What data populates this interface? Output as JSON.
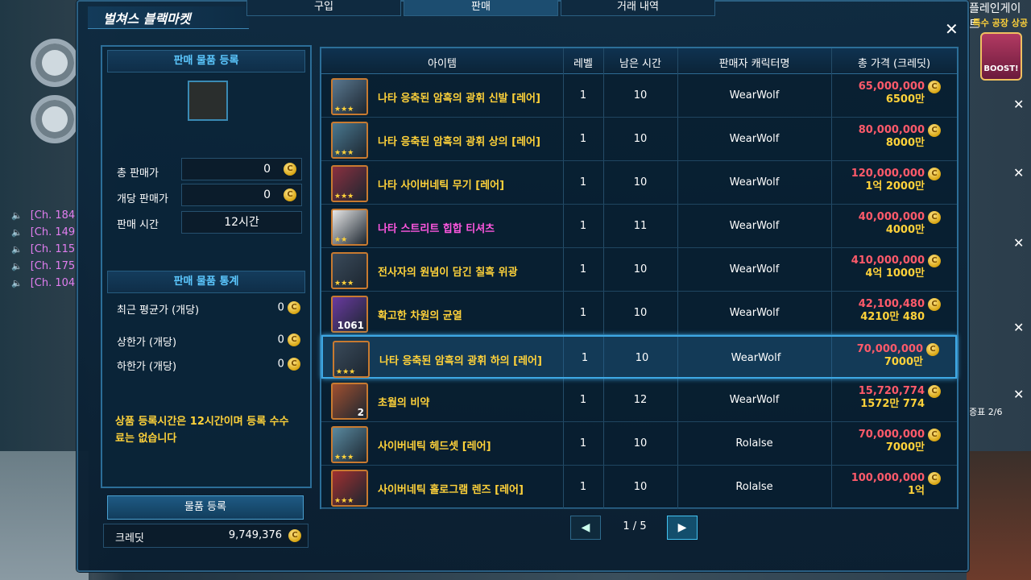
{
  "window": {
    "title": "벌쳐스 블랙마켓",
    "tabs": [
      {
        "label": "구입"
      },
      {
        "label": "판매"
      },
      {
        "label": "거래 내역"
      }
    ],
    "active_tab": 1,
    "close": "✕"
  },
  "left": {
    "register_header": "판매 물품 등록",
    "total_price_label": "총 판매가",
    "total_price_value": "0",
    "unit_price_label": "개당 판매가",
    "unit_price_value": "0",
    "sell_time_label": "판매 시간",
    "sell_time_value": "12시간",
    "stats_header": "판매 물품 통계",
    "recent_avg_label": "최근 평균가 (개당)",
    "recent_avg_value": "0",
    "upper_label": "상한가 (개당)",
    "upper_value": "0",
    "lower_label": "하한가 (개당)",
    "lower_value": "0",
    "notice": "상품 등록시간은 12시간이며 등록 수수료는 없습니다",
    "register_button": "물품 등록",
    "credit_label": "크레딧",
    "credit_value": "9,749,376"
  },
  "table": {
    "headers": [
      "아이템",
      "레벨",
      "남은 시간",
      "판매자 캐릭터명",
      "총 가격 (크레딧)"
    ],
    "rows": [
      {
        "name": "나타 응축된 암흑의 광휘 신발 [레어]",
        "level": "1",
        "time": "10",
        "seller": "WearWolf",
        "price": "65,000,000",
        "price_sub": "6500만",
        "stars": "★★★",
        "count": "",
        "color": "gold"
      },
      {
        "name": "나타 응축된 암흑의 광휘 상의 [레어]",
        "level": "1",
        "time": "10",
        "seller": "WearWolf",
        "price": "80,000,000",
        "price_sub": "8000만",
        "stars": "★★★",
        "count": "",
        "color": "gold"
      },
      {
        "name": "나타 사이버네틱 무기 [레어]",
        "level": "1",
        "time": "10",
        "seller": "WearWolf",
        "price": "120,000,000",
        "price_sub": "1억 2000만",
        "stars": "★★★",
        "count": "",
        "color": "gold"
      },
      {
        "name": "나타 스트리트 힙합 티셔츠",
        "level": "1",
        "time": "11",
        "seller": "WearWolf",
        "price": "40,000,000",
        "price_sub": "4000만",
        "stars": "★★",
        "count": "",
        "color": "pink"
      },
      {
        "name": "전사자의 원념이 담긴 칠흑 위광",
        "level": "1",
        "time": "10",
        "seller": "WearWolf",
        "price": "410,000,000",
        "price_sub": "4억 1000만",
        "stars": "★★★",
        "count": "",
        "color": "gold"
      },
      {
        "name": "확고한 차원의 균열",
        "level": "1",
        "time": "10",
        "seller": "WearWolf",
        "price": "42,100,480",
        "price_sub": "4210만 480",
        "stars": "",
        "count": "1061",
        "color": "gold"
      },
      {
        "name": "나타 응축된 암흑의 광휘 하의 [레어]",
        "level": "1",
        "time": "10",
        "seller": "WearWolf",
        "price": "70,000,000",
        "price_sub": "7000만",
        "stars": "★★★",
        "count": "",
        "color": "gold"
      },
      {
        "name": "초월의 비약",
        "level": "1",
        "time": "12",
        "seller": "WearWolf",
        "price": "15,720,774",
        "price_sub": "1572만 774",
        "stars": "",
        "count": "2",
        "color": "gold"
      },
      {
        "name": "사이버네틱 헤드셋 [레어]",
        "level": "1",
        "time": "10",
        "seller": "Rolalse",
        "price": "70,000,000",
        "price_sub": "7000만",
        "stars": "★★★",
        "count": "",
        "color": "gold"
      },
      {
        "name": "사이버네틱 홀로그램 렌즈 [레어]",
        "level": "1",
        "time": "10",
        "seller": "Rolalse",
        "price": "100,000,000",
        "price_sub": "1억",
        "stars": "★★★",
        "count": "",
        "color": "gold"
      }
    ],
    "selected_row": 6
  },
  "pager": {
    "text": "1 / 5",
    "prev": "◀",
    "next": "▶"
  },
  "hud": {
    "gate_title": "플레인게이트",
    "gate_sub": "특수 공장 상공",
    "boost": "BOOST!",
    "proof": "증표 2/6",
    "chat": [
      "[Ch. 184",
      "[Ch. 149",
      "[Ch. 115",
      "[Ch. 175",
      "[Ch. 104"
    ]
  }
}
